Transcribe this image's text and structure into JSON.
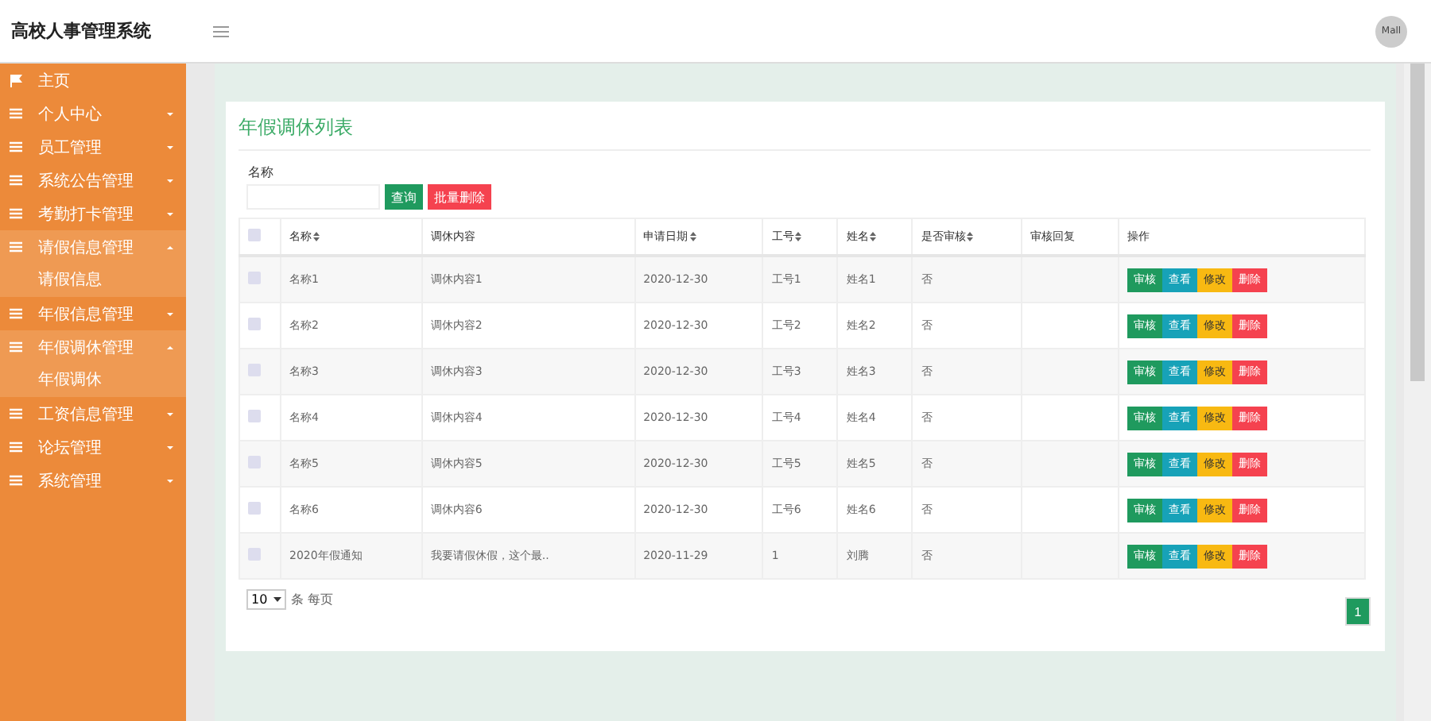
{
  "header": {
    "title": "高校人事管理系统",
    "avatar": "Mall"
  },
  "sidebar": {
    "items": [
      {
        "kind": "home",
        "label": "主页",
        "expanded": false
      },
      {
        "kind": "menu",
        "label": "个人中心",
        "expanded": false
      },
      {
        "kind": "menu",
        "label": "员工管理",
        "expanded": false
      },
      {
        "kind": "menu",
        "label": "系统公告管理",
        "expanded": false
      },
      {
        "kind": "menu",
        "label": "考勤打卡管理",
        "expanded": false
      },
      {
        "kind": "menu",
        "label": "请假信息管理",
        "expanded": true,
        "children": [
          {
            "label": "请假信息"
          }
        ]
      },
      {
        "kind": "menu",
        "label": "年假信息管理",
        "expanded": false
      },
      {
        "kind": "menu",
        "label": "年假调休管理",
        "expanded": true,
        "children": [
          {
            "label": "年假调休"
          }
        ]
      },
      {
        "kind": "menu",
        "label": "工资信息管理",
        "expanded": false
      },
      {
        "kind": "menu",
        "label": "论坛管理",
        "expanded": false
      },
      {
        "kind": "menu",
        "label": "系统管理",
        "expanded": false
      }
    ]
  },
  "panel": {
    "title": "年假调休列表",
    "search": {
      "label": "名称",
      "search_button": "查询",
      "delete_button": "批量删除"
    },
    "table": {
      "all_checked": false,
      "columns": [
        {
          "label": "名称",
          "sortable": true
        },
        {
          "label": "调休内容",
          "sortable": false
        },
        {
          "label": "申请日期",
          "sortable": true
        },
        {
          "label": "工号",
          "sortable": true
        },
        {
          "label": "姓名",
          "sortable": true
        },
        {
          "label": "是否审核",
          "sortable": true
        },
        {
          "label": "审核回复",
          "sortable": false
        },
        {
          "label": "操作",
          "sortable": false
        }
      ],
      "rows": [
        {
          "checked": false,
          "cells": [
            "名称1",
            "调休内容1",
            "2020-12-30",
            "工号1",
            "姓名1",
            "否",
            ""
          ],
          "actions": [
            "审核",
            "查看",
            "修改",
            "删除"
          ]
        },
        {
          "checked": false,
          "cells": [
            "名称2",
            "调休内容2",
            "2020-12-30",
            "工号2",
            "姓名2",
            "否",
            ""
          ],
          "actions": [
            "审核",
            "查看",
            "修改",
            "删除"
          ]
        },
        {
          "checked": false,
          "cells": [
            "名称3",
            "调休内容3",
            "2020-12-30",
            "工号3",
            "姓名3",
            "否",
            ""
          ],
          "actions": [
            "审核",
            "查看",
            "修改",
            "删除"
          ]
        },
        {
          "checked": false,
          "cells": [
            "名称4",
            "调休内容4",
            "2020-12-30",
            "工号4",
            "姓名4",
            "否",
            ""
          ],
          "actions": [
            "审核",
            "查看",
            "修改",
            "删除"
          ]
        },
        {
          "checked": false,
          "cells": [
            "名称5",
            "调休内容5",
            "2020-12-30",
            "工号5",
            "姓名5",
            "否",
            ""
          ],
          "actions": [
            "审核",
            "查看",
            "修改",
            "删除"
          ]
        },
        {
          "checked": false,
          "cells": [
            "名称6",
            "调休内容6",
            "2020-12-30",
            "工号6",
            "姓名6",
            "否",
            ""
          ],
          "actions": [
            "审核",
            "查看",
            "修改",
            "删除"
          ]
        },
        {
          "checked": false,
          "cells": [
            "2020年假通知",
            "我要请假休假，这个最..",
            "2020-11-29",
            "1",
            "刘腾",
            "否",
            ""
          ],
          "actions": [
            "审核",
            "查看",
            "修改",
            "删除"
          ]
        }
      ]
    },
    "page_size": "10",
    "page_size_label": "条 每页",
    "pages": [
      {
        "label": "1",
        "selected": true
      }
    ]
  }
}
